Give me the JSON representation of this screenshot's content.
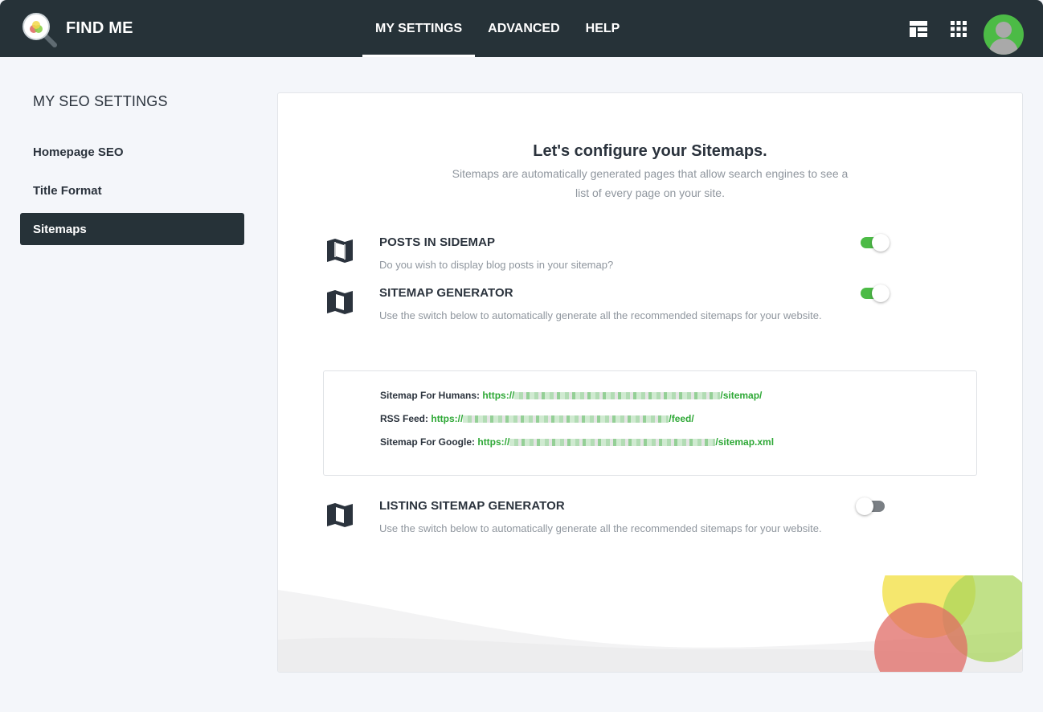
{
  "app": {
    "title": "FIND ME"
  },
  "nav": {
    "tabs": [
      {
        "label": "MY SETTINGS",
        "active": true
      },
      {
        "label": "ADVANCED",
        "active": false
      },
      {
        "label": "HELP",
        "active": false
      }
    ],
    "icons": [
      "dashboard-icon",
      "apps-grid-icon",
      "user-avatar"
    ]
  },
  "sidebar": {
    "title": "MY SEO SETTINGS",
    "items": [
      {
        "label": "Homepage SEO",
        "active": false
      },
      {
        "label": "Title Format",
        "active": false
      },
      {
        "label": "Sitemaps",
        "active": true
      }
    ]
  },
  "main": {
    "title": "Let's configure your Sitemaps.",
    "subtitle": "Sitemaps are automatically generated pages that allow search engines to see a list of every page on your site.",
    "settings": [
      {
        "title": "POSTS IN SIDEMAP",
        "description": "Do you wish to display blog posts in your sitemap?",
        "enabled": true,
        "icon": "map-icon"
      },
      {
        "title": "SITEMAP GENERATOR",
        "description": "Use the switch below to automatically generate all the recommended sitemaps for your website.",
        "enabled": true,
        "icon": "map-icon"
      },
      {
        "title": "LISTING SITEMAP GENERATOR",
        "description": "Use the switch below to automatically generate all the recommended sitemaps for your website.",
        "enabled": false,
        "icon": "map-icon"
      }
    ],
    "links": [
      {
        "label": "Sitemap For Humans:",
        "url_prefix": "https://",
        "url_suffix": "/sitemap/"
      },
      {
        "label": "RSS Feed:",
        "url_prefix": "https://",
        "url_suffix": "/feed/"
      },
      {
        "label": "Sitemap For Google:",
        "url_prefix": "https://",
        "url_suffix": "/sitemap.xml"
      }
    ]
  },
  "colors": {
    "topbar": "#263238",
    "accent_green": "#4cbb46",
    "link_green": "#2ea836",
    "toggle_off": "#7a7f84"
  }
}
